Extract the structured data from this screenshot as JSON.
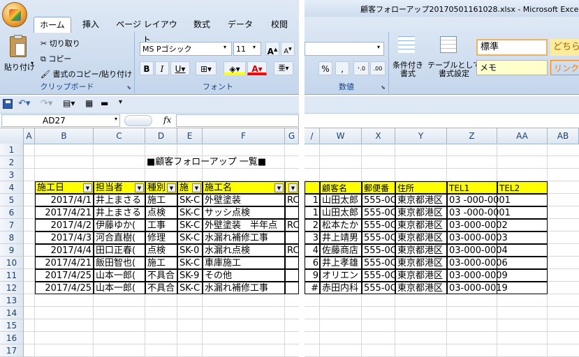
{
  "title_bar": {
    "title": "顧客フォローアップ20170501161028.xlsx - Microsoft Excel"
  },
  "tabs": [
    "ホーム",
    "挿入",
    "ページ レイアウト",
    "数式",
    "データ",
    "校閲"
  ],
  "clipboard": {
    "paste": "貼り付け",
    "cut": "切り取り",
    "copy": "コピー",
    "format_painter": "書式のコピー/貼り付け",
    "group": "クリップボード"
  },
  "font": {
    "name": "MS Pゴシック",
    "size": "11",
    "group": "フォント"
  },
  "number": {
    "group": "数値",
    "percent": "%",
    "comma": ","
  },
  "styles": {
    "cond": "条件付き\n書式",
    "table": "テーブルとして\n書式設定",
    "standard": "標準",
    "memo": "メモ",
    "good": "どちら",
    "link": "リンク"
  },
  "formula_bar": {
    "name_box": "AD27",
    "fx": "fx"
  },
  "left_columns": [
    "A",
    "B",
    "C",
    "D",
    "E",
    "F",
    "G"
  ],
  "right_columns": [
    "W",
    "X",
    "Y",
    "Z",
    "AA",
    "AB"
  ],
  "rows": [
    "1",
    "2",
    "3",
    "4",
    "5",
    "6",
    "7",
    "8",
    "9",
    "10",
    "11",
    "12",
    "13",
    "14",
    "15",
    "16",
    "17"
  ],
  "sheet_title": "■顧客フォローアップ 一覧■",
  "left_headers": [
    "施工日",
    "担当者",
    "種別",
    "施",
    "施工名",
    ""
  ],
  "left_data": [
    [
      "2017/4/1",
      "井上まさる",
      "施工",
      "SK-C",
      "外壁塗装",
      "RC"
    ],
    [
      "2017/4/21",
      "井上まさる",
      "点検",
      "SK-C",
      "サッシ点検",
      ""
    ],
    [
      "2017/4/2",
      "伊藤ゆか(",
      "工事",
      "SK-C",
      "外壁塗装　半年点",
      "RC"
    ],
    [
      "2017/4/3",
      "河合直樹(",
      "修理",
      "SK-C",
      "水漏れ補修工事",
      ""
    ],
    [
      "2017/4/4",
      "田口正春(",
      "点検",
      "SK-0",
      "水漏れ点検",
      "RC"
    ],
    [
      "2017/4/21",
      "飯田智也(",
      "施工",
      "SK-C",
      "車庫施工",
      ""
    ],
    [
      "2017/4/25",
      "山本一郎(",
      "不具合",
      "SK-9",
      "その他",
      ""
    ],
    [
      "2017/4/25",
      "山本一郎(",
      "不具合",
      "SK-C",
      "水漏れ補修工事",
      ""
    ]
  ],
  "right_headers": [
    "顧客名",
    "郵便番",
    "住所",
    "TEL1",
    "TEL2"
  ],
  "right_data": [
    [
      "1",
      "山田太郎",
      "555-0C",
      "東京都港区",
      "03 -000-0001"
    ],
    [
      "1",
      "山田太郎",
      "555-0C",
      "東京都港区",
      "03 -000-0001"
    ],
    [
      "2",
      "松本たか",
      "555-0C",
      "東京都港区",
      "03-000-0002"
    ],
    [
      "3",
      "井上靖男",
      "555-0C",
      "東京都港区",
      "03-000-0003"
    ],
    [
      "4",
      "佐藤商店",
      "555-0C",
      "東京都港区",
      "03-000-0004"
    ],
    [
      "6",
      "井上孝雄",
      "555-0C",
      "東京都港区",
      "03-000-0006"
    ],
    [
      "9",
      "オリエント",
      "555-0C",
      "東京都港区",
      "03-000-0009"
    ],
    [
      "#",
      "赤田内科",
      "555-0C",
      "東京都港区",
      "03-000-0019"
    ]
  ]
}
